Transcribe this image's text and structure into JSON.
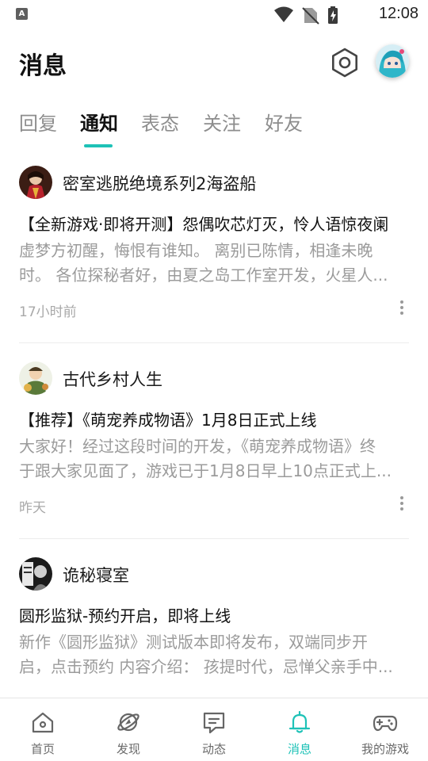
{
  "status_bar": {
    "time": "12:08",
    "app_badge": "A"
  },
  "header": {
    "title": "消息"
  },
  "tabs": [
    {
      "label": "回复",
      "active": false
    },
    {
      "label": "通知",
      "active": true
    },
    {
      "label": "表态",
      "active": false
    },
    {
      "label": "关注",
      "active": false
    },
    {
      "label": "好友",
      "active": false
    }
  ],
  "notifications": [
    {
      "sender": "密室逃脱绝境系列2海盗船",
      "headline": "【全新游戏·即将开测】怨偶吹芯灯灭，怜人语惊夜阑",
      "body_lines": [
        "虚梦方初醒，悔恨有谁知。 离别已陈情，相逢未晚",
        "时。 各位探秘者好，由夏之岛工作室开发，火星人..."
      ],
      "time": "17小时前"
    },
    {
      "sender": "古代乡村人生",
      "headline": "【推荐】《萌宠养成物语》1月8日正式上线",
      "body_lines": [
        "大家好！经过这段时间的开发，《萌宠养成物语》终",
        "于跟大家见面了，游戏已于1月8日早上10点正式上..."
      ],
      "time": "昨天"
    },
    {
      "sender": "诡秘寝室",
      "headline": "圆形监狱-预约开启，即将上线",
      "body_lines": [
        "新作《圆形监狱》测试版本即将发布，双端同步开",
        "启，点击预约 内容介绍： 孩提时代，忌惮父亲手中..."
      ],
      "time": ""
    }
  ],
  "bottom_nav": [
    {
      "label": "首页",
      "icon": "home-icon",
      "active": false
    },
    {
      "label": "发现",
      "icon": "planet-icon",
      "active": false
    },
    {
      "label": "动态",
      "icon": "chat-icon",
      "active": false
    },
    {
      "label": "消息",
      "icon": "bell-icon",
      "active": true
    },
    {
      "label": "我的游戏",
      "icon": "gamepad-icon",
      "active": false
    }
  ],
  "colors": {
    "accent": "#1ec2b7",
    "text_primary": "#111111",
    "text_secondary": "#9b9b9b",
    "tab_inactive": "#8d8d8d"
  }
}
